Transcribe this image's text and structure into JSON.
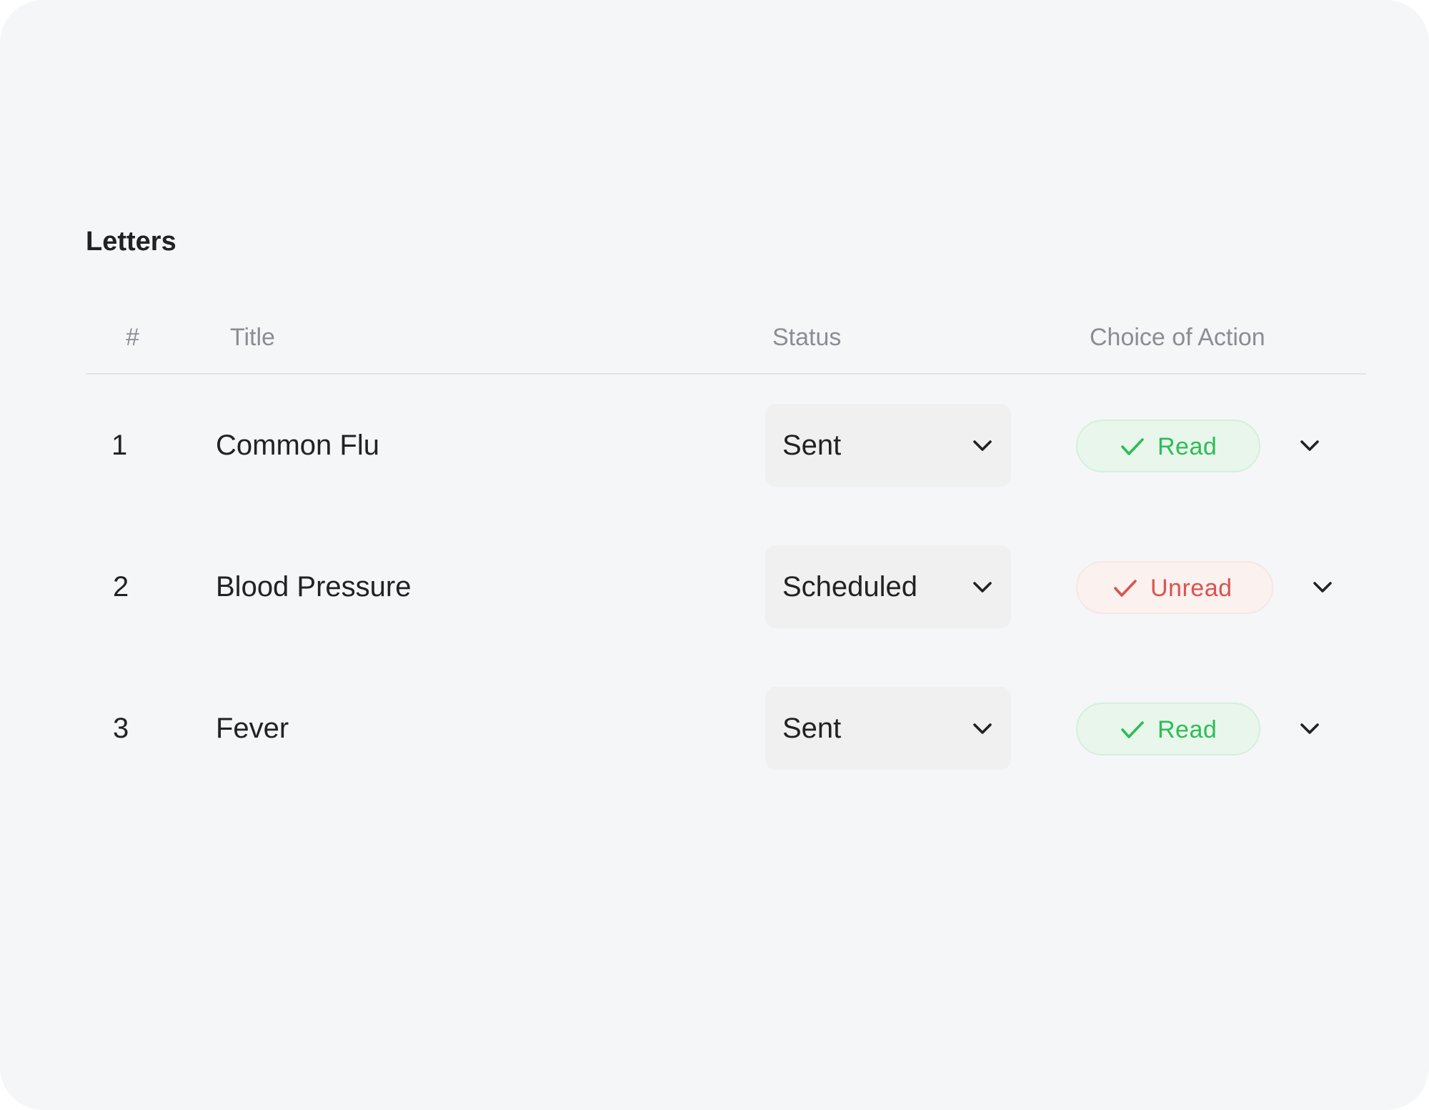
{
  "page": {
    "title": "Letters"
  },
  "table": {
    "headers": {
      "num": "#",
      "title": "Title",
      "status": "Status",
      "action": "Choice of Action"
    },
    "rows": [
      {
        "num": "1",
        "title": "Common Flu",
        "status": "Sent",
        "action": "Read",
        "action_state": "read",
        "status_icon": "chevron-down-icon",
        "action_icon": "check-icon"
      },
      {
        "num": "2",
        "title": "Blood Pressure",
        "status": "Scheduled",
        "action": "Unread",
        "action_state": "unread",
        "status_icon": "chevron-down-icon",
        "action_icon": "check-icon"
      },
      {
        "num": "3",
        "title": "Fever",
        "status": "Sent",
        "action": "Read",
        "action_state": "read",
        "status_icon": "chevron-down-icon",
        "action_icon": "check-icon"
      }
    ]
  },
  "colors": {
    "background": "#f5f6f8",
    "read_text": "#2ebd55",
    "read_bg": "#e8f6ec",
    "unread_text": "#d9534f",
    "unread_bg": "#fbf1ef",
    "select_bg": "#f0f0f1",
    "header_text": "#8a8d93"
  }
}
